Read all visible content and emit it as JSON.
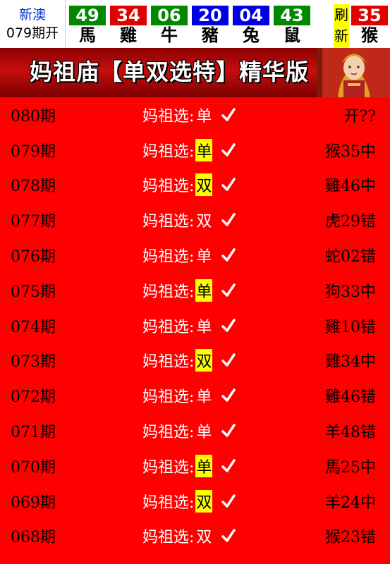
{
  "header": {
    "source_name": "新澳",
    "issue_label": "079期开",
    "balls": [
      {
        "number": "49",
        "zodiac": "馬",
        "color": "#008800"
      },
      {
        "number": "34",
        "zodiac": "雞",
        "color": "#e00000"
      },
      {
        "number": "06",
        "zodiac": "牛",
        "color": "#008800"
      },
      {
        "number": "20",
        "zodiac": "豬",
        "color": "#0000e6"
      },
      {
        "number": "04",
        "zodiac": "兔",
        "color": "#0000e6"
      },
      {
        "number": "43",
        "zodiac": "鼠",
        "color": "#008800"
      }
    ],
    "refresh_label": [
      "刷",
      "新"
    ],
    "special_ball": {
      "number": "35",
      "zodiac": "猴",
      "color": "#e00000"
    }
  },
  "banner": {
    "title": "妈祖庙【单双选特】精华版"
  },
  "pick_prefix": "妈祖选:",
  "rows": [
    {
      "issue": "080期",
      "pick": "单",
      "highlight": false,
      "result": "开??"
    },
    {
      "issue": "079期",
      "pick": "单",
      "highlight": true,
      "result": "猴35中"
    },
    {
      "issue": "078期",
      "pick": "双",
      "highlight": true,
      "result": "雞46中"
    },
    {
      "issue": "077期",
      "pick": "双",
      "highlight": false,
      "result": "虎29错"
    },
    {
      "issue": "076期",
      "pick": "单",
      "highlight": false,
      "result": "蛇02错"
    },
    {
      "issue": "075期",
      "pick": "单",
      "highlight": true,
      "result": "狗33中"
    },
    {
      "issue": "074期",
      "pick": "单",
      "highlight": false,
      "result": "雞10错"
    },
    {
      "issue": "073期",
      "pick": "双",
      "highlight": true,
      "result": "雞34中"
    },
    {
      "issue": "072期",
      "pick": "单",
      "highlight": false,
      "result": "雞46错"
    },
    {
      "issue": "071期",
      "pick": "单",
      "highlight": false,
      "result": "羊48错"
    },
    {
      "issue": "070期",
      "pick": "单",
      "highlight": true,
      "result": "馬25中"
    },
    {
      "issue": "069期",
      "pick": "双",
      "highlight": true,
      "result": "羊24中"
    },
    {
      "issue": "068期",
      "pick": "双",
      "highlight": false,
      "result": "猴23错"
    }
  ],
  "colors": {
    "page_background": "#ff0000",
    "highlight": "#ffff00",
    "issue_text": "#000000",
    "pick_text": "#ffffff"
  }
}
